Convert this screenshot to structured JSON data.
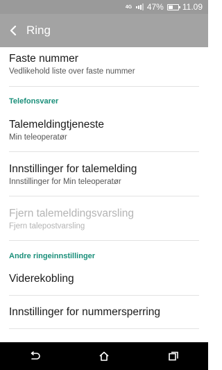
{
  "status_bar": {
    "network": "4G",
    "battery": "47%",
    "battery_level": 0.47,
    "time": "11.09"
  },
  "app_bar": {
    "title": "Ring",
    "back_icon": "back-arrow-icon"
  },
  "items": {
    "fixed_numbers": {
      "title": "Faste nummer",
      "subtitle": "Vedlikehold liste over faste nummer"
    },
    "voicemail_header": "Telefonsvarer",
    "voicemail_service": {
      "title": "Talemeldingtjeneste",
      "subtitle": "Min teleoperatør"
    },
    "voicemail_settings": {
      "title": "Innstillinger for talemelding",
      "subtitle": "Innstillinger for Min teleoperatør"
    },
    "voicemail_notification": {
      "title": "Fjern talemeldingsvarsling",
      "subtitle": "Fjern talepostvarsling"
    },
    "other_header": "Andre ringeinnstillinger",
    "call_forwarding": {
      "title": "Viderekobling"
    },
    "call_barring": {
      "title": "Innstillinger for nummersperring"
    }
  },
  "nav_bar": {
    "back": "back-icon",
    "home": "home-icon",
    "recents": "recent-apps-icon"
  },
  "colors": {
    "status_bar": "#9a9a9a",
    "app_bar": "#a3a3a3",
    "section_header": "#1a8f7a",
    "nav_bar": "#000000"
  }
}
